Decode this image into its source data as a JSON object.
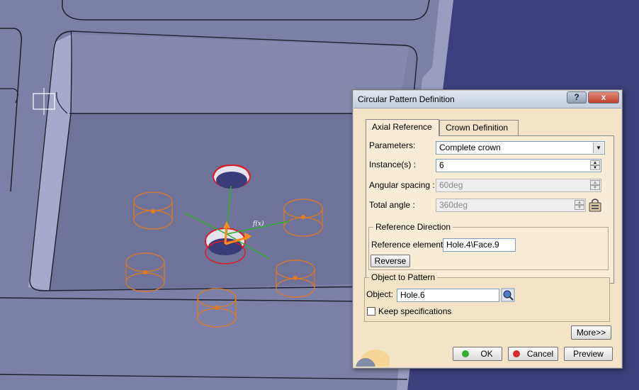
{
  "dialog": {
    "title": "Circular Pattern Definition",
    "help_label": "?",
    "close_label": "x",
    "tabs": [
      {
        "label": "Axial Reference",
        "active": true
      },
      {
        "label": "Crown Definition",
        "active": false
      }
    ],
    "parameters": {
      "label": "Parameters:",
      "value": "Complete crown"
    },
    "instances": {
      "label": "Instance(s) :",
      "value": "6"
    },
    "angular_spacing": {
      "label": "Angular spacing :",
      "value": "60deg"
    },
    "total_angle": {
      "label": "Total angle :",
      "value": "360deg"
    },
    "reference_direction": {
      "title": "Reference Direction",
      "element_label": "Reference element:",
      "element_value": "Hole.4\\Face.9",
      "reverse_label": "Reverse"
    },
    "object_to_pattern": {
      "title": "Object to Pattern",
      "object_label": "Object:",
      "object_value": "Hole.6",
      "keep_spec_label": "Keep specifications",
      "keep_spec_checked": false
    },
    "more_label": "More>>",
    "ok_label": "OK",
    "cancel_label": "Cancel",
    "preview_label": "Preview",
    "colors": {
      "ok_dot": "#2fae2f",
      "cancel_dot": "#d62b2b"
    }
  },
  "viewport": {
    "compass_label": "f(x)",
    "colors": {
      "part_face": "#8184a9",
      "background": "#3c3f78",
      "pattern_instance": "#e07a1e",
      "selected_hole": "#d9202a"
    }
  }
}
